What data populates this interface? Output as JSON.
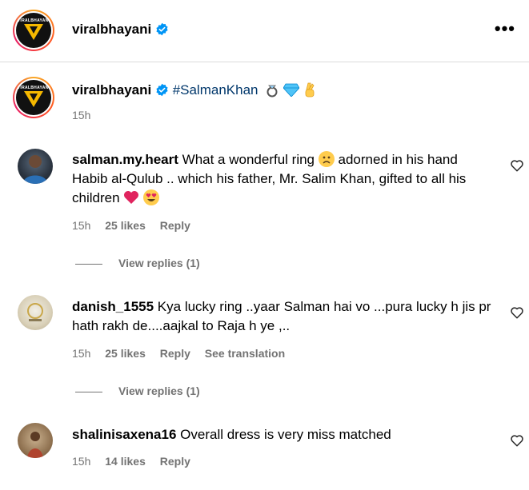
{
  "header": {
    "username": "viralbhayani",
    "brand_text": "VIRALBHAYANI",
    "menu_icon": "more-horizontal-icon"
  },
  "caption": {
    "username": "viralbhayani",
    "hashtag": "#SalmanKhan",
    "emojis": [
      "ring-icon",
      "gem-icon",
      "crossed-fingers-icon"
    ],
    "time": "15h"
  },
  "comments": [
    {
      "username": "salman.my.heart",
      "text_part1": "What a wonderful ring",
      "text_part2": "adorned in his hand Habib al-Qulub .. which his father, Mr. Salim Khan, gifted to all his children",
      "time": "15h",
      "likes": "25 likes",
      "reply": "Reply",
      "view_replies": "View replies (1)"
    },
    {
      "username": "danish_1555",
      "text": "Kya lucky ring ..yaar Salman hai vo ...pura lucky h jis pr hath rakh de....aajkal to Raja h ye ,..",
      "time": "15h",
      "likes": "25 likes",
      "reply": "Reply",
      "translate": "See translation",
      "view_replies": "View replies (1)"
    },
    {
      "username": "shalinisaxena16",
      "text": "Overall dress is very miss matched",
      "time": "15h",
      "likes": "14 likes",
      "reply": "Reply"
    }
  ],
  "colors": {
    "hashtag": "#00376b",
    "muted": "#737373",
    "verified": "#0095f6",
    "divider": "#dbdbdb"
  }
}
